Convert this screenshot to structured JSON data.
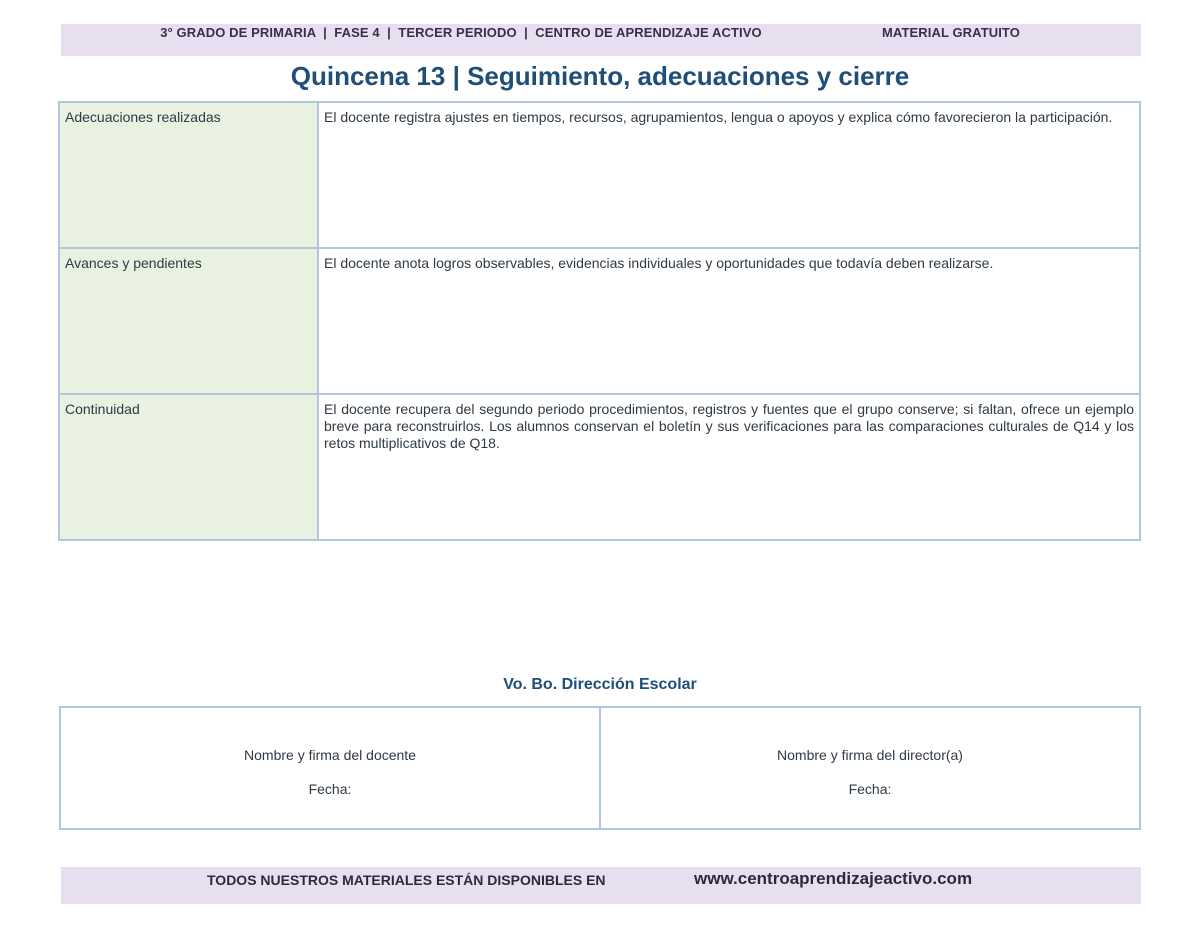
{
  "header": {
    "info": "3° GRADO DE PRIMARIA  |  FASE 4  |  TERCER PERIODO  |  CENTRO DE APRENDIZAJE ACTIVO",
    "free_label": "MATERIAL GRATUITO"
  },
  "title": "Quincena 13 | Seguimiento, adecuaciones y cierre",
  "rows": [
    {
      "label": "Adecuaciones realizadas",
      "content": "El docente registra ajustes en tiempos, recursos, agrupamientos, lengua o apoyos y explica cómo favorecieron la participación."
    },
    {
      "label": "Avances y pendientes",
      "content": "El docente anota logros observables, evidencias individuales y oportunidades que todavía deben realizarse."
    },
    {
      "label": "Continuidad",
      "content": "El docente recupera del segundo periodo procedimientos, registros y fuentes que el grupo conserve; si faltan, ofrece un ejemplo breve para reconstruirlos. Los alumnos conservan el boletín y sus verificaciones para las comparaciones culturales de Q14 y los retos multiplicativos de Q18."
    }
  ],
  "approval": {
    "title": "Vo. Bo. Dirección Escolar",
    "teacher_signature": "Nombre y firma del docente",
    "teacher_date": "Fecha:",
    "director_signature": "Nombre y firma del director(a)",
    "director_date": "Fecha:"
  },
  "footer": {
    "text": "TODOS NUESTROS MATERIALES ESTÁN DISPONIBLES EN",
    "url": "www.centroaprendizajeactivo.com"
  }
}
